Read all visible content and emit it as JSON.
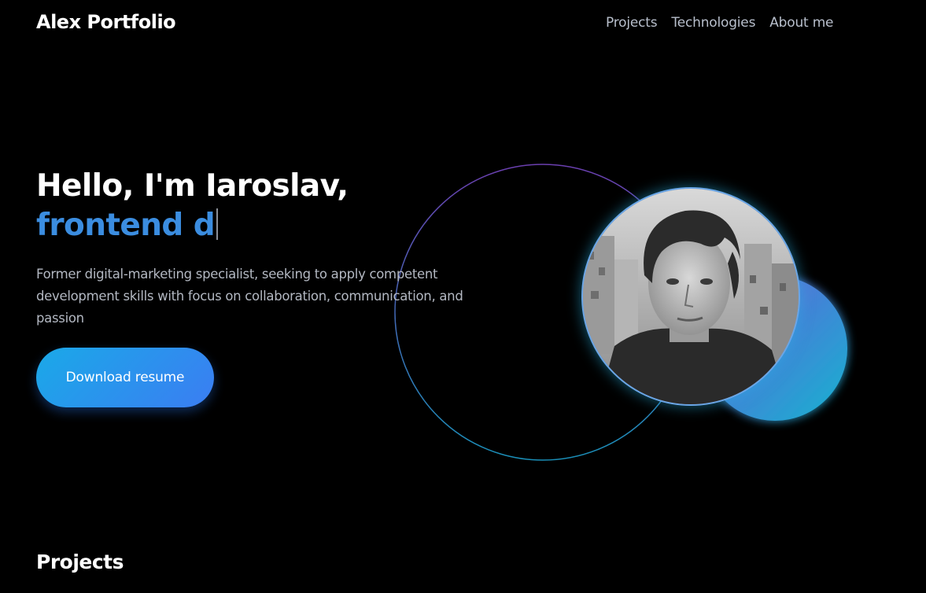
{
  "header": {
    "brand": "Alex Portfolio",
    "nav": [
      {
        "label": "Projects"
      },
      {
        "label": "Technologies"
      },
      {
        "label": "About me"
      }
    ]
  },
  "hero": {
    "greeting": "Hello, I'm Iaroslav,",
    "typed_text": "frontend d",
    "description": "Former digital-marketing specialist, seeking to apply competent development skills with focus on collaboration, communication, and passion",
    "button_label": "Download resume"
  },
  "sections": {
    "projects_title": "Projects"
  },
  "colors": {
    "background": "#000000",
    "accent_blue": "#3b8de0",
    "button_gradient_start": "#1aa9e8",
    "button_gradient_end": "#3b7df2",
    "nav_text": "#b8bfcc",
    "body_text": "#b3b8c2"
  }
}
